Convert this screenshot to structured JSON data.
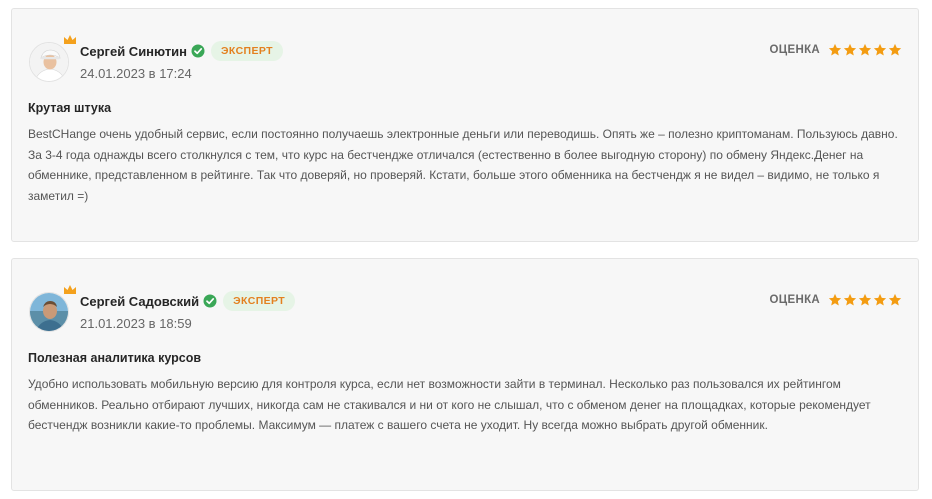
{
  "reviews": [
    {
      "author": "Сергей Синютин",
      "badge": "ЭКСПЕРТ",
      "date": "24.01.2023 в 17:24",
      "rating_label": "ОЦЕНКА",
      "rating": 5,
      "title": "Крутая штука",
      "text": "BestCHange очень удобный сервис, если постоянно получаешь электронные деньги или переводишь. Опять же – полезно криптоманам. Пользуюсь давно. За 3-4 года однажды всего столкнулся с тем, что курс на бестчендже отличался (естественно в более выгодную сторону) по обмену Яндекс.Денег на обменнике, представленном в рейтинге. Так что доверяй, но проверяй. Кстати, больше этого обменника на бестчендж я не видел – видимо, не только я заметил =)",
      "avatar": "avatar-man-white-cap",
      "verified_icon": "verified-check-icon"
    },
    {
      "author": "Сергей Садовский",
      "badge": "ЭКСПЕРТ",
      "date": "21.01.2023 в 18:59",
      "rating_label": "ОЦЕНКА",
      "rating": 5,
      "title": "Полезная аналитика курсов",
      "text": "Удобно использовать мобильную версию для контроля курса, если нет возможности зайти в терминал. Несколько раз пользовался их рейтингом обменников. Реально отбирают лучших, никогда сам не стакивался и ни от кого не слышал, что с обменом денег на площадках, которые рекомендует бестчендж возникли какие-то проблемы. Максимум — платеж с вашего счета не уходит. Ну всегда можно выбрать другой обменник.",
      "avatar": "avatar-man-sea-background",
      "verified_icon": "verified-check-icon"
    }
  ],
  "colors": {
    "star": "#f39c12",
    "verified": "#3aa757",
    "badge_text": "#e3801f",
    "badge_bg": "#e6f4e6",
    "crown": "#f4a11d"
  }
}
